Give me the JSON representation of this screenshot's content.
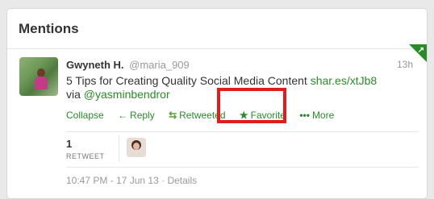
{
  "header": {
    "title": "Mentions"
  },
  "tweet": {
    "name": "Gwyneth H.",
    "handle": "@maria_909",
    "time": "13h",
    "text_main": "5 Tips for Creating Quality Social Media Content",
    "link_url": "shar.es/xtJb8",
    "via_prefix": "via",
    "via_handle": "@yasminbendror",
    "actions": {
      "collapse": "Collapse",
      "reply": "Reply",
      "retweeted": "Retweeted",
      "favorite": "Favorite",
      "more": "More"
    },
    "icons": {
      "reply": "←",
      "retweeted": "⇆",
      "favorite": "★",
      "more": "•••"
    },
    "stats": {
      "count": "1",
      "label": "RETWEET"
    },
    "footer": {
      "timestamp": "10:47 PM - 17 Jun 13",
      "separator": "·",
      "details": "Details"
    }
  }
}
